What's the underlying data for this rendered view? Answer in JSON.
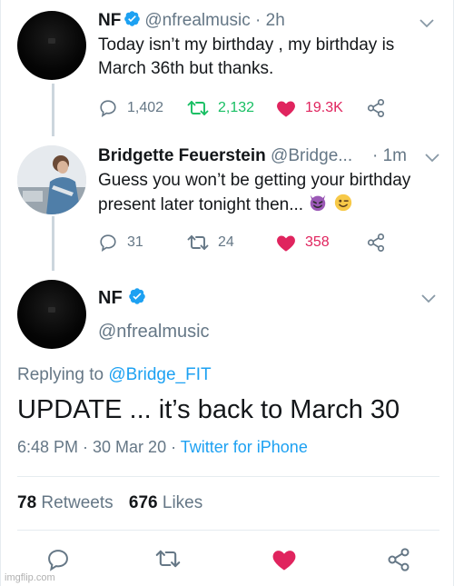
{
  "colors": {
    "blue": "#1da1f2",
    "gray": "#657786",
    "green": "#17bf63",
    "red": "#e0245e",
    "text": "#14171a"
  },
  "tweet1": {
    "name": "NF",
    "handle_time": "@nfrealmusic · 2h",
    "lines": [
      "Today isn’t my birthday , my birthday is",
      "March 36th but thanks."
    ],
    "replies": "1,402",
    "retweets": "2,132",
    "likes": "19.3K"
  },
  "tweet2": {
    "name": "Bridgette Feuerstein",
    "handle": "@Bridge...",
    "time": "· 1m",
    "lines": [
      "Guess you won’t be getting your birthday",
      "present later tonight then..."
    ],
    "emoji": [
      "smiling-devil-emoji",
      "winking-face-emoji"
    ],
    "replies": "31",
    "retweets": "24",
    "likes": "358"
  },
  "focus": {
    "name": "NF",
    "handle": "@nfrealmusic",
    "replying_prefix": "Replying to",
    "replying_handle": "@Bridge_FIT",
    "text": "UPDATE ... it’s back to March 30",
    "datetime": "6:48 PM · 30 Mar 20 ·",
    "source": "Twitter for iPhone",
    "retweets_count": "78",
    "retweets_label": "Retweets",
    "likes_count": "676",
    "likes_label": "Likes"
  },
  "icons": [
    "reply-icon",
    "retweet-icon",
    "heart-icon",
    "share-icon",
    "verified-icon",
    "chevron-down-icon"
  ],
  "watermark": "imgflip.com"
}
